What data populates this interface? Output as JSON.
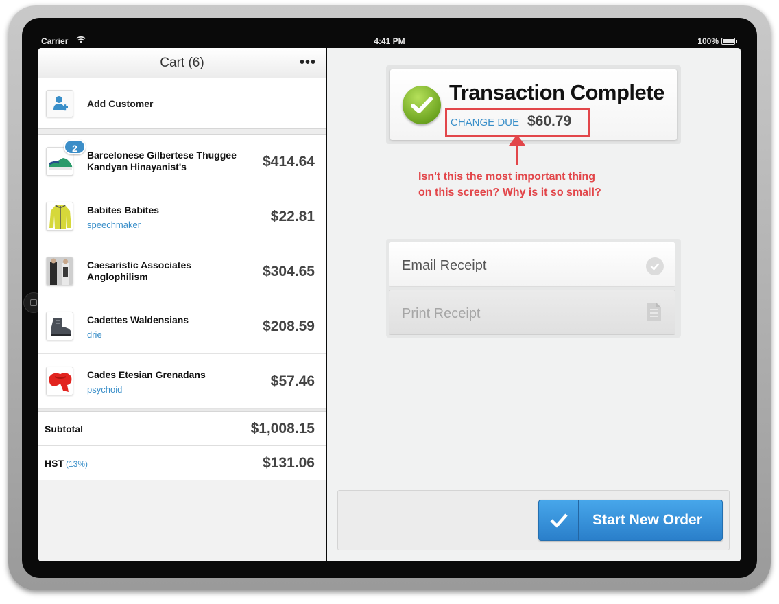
{
  "status_bar": {
    "carrier": "Carrier",
    "time": "4:41 PM",
    "battery": "100%"
  },
  "cart": {
    "title": "Cart (6)",
    "add_customer_label": "Add Customer",
    "items": [
      {
        "name": "Barcelonese Gilbertese Thuggee Kandyan Hinayanist's",
        "sub": "",
        "price": "$414.64",
        "qty_badge": "2",
        "image": "sneaker"
      },
      {
        "name": "Babites Babites",
        "sub": "speechmaker",
        "price": "$22.81",
        "image": "yellow-jacket"
      },
      {
        "name": "Caesaristic Associates Anglophilism",
        "sub": "",
        "price": "$304.65",
        "image": "fashion-models"
      },
      {
        "name": "Cadettes Waldensians",
        "sub": "drie",
        "price": "$208.59",
        "image": "boot"
      },
      {
        "name": "Cades Etesian Grenadans",
        "sub": "psychoid",
        "price": "$57.46",
        "image": "red-scarf"
      }
    ],
    "subtotal_label": "Subtotal",
    "subtotal_value": "$1,008.15",
    "tax_label": "HST",
    "tax_rate": "(13%)",
    "tax_value": "$131.06"
  },
  "transaction": {
    "title": "Transaction Complete",
    "change_due_label": "CHANGE DUE",
    "change_due_amount": "$60.79"
  },
  "annotation": {
    "line1": "Isn't this the most important thing",
    "line2": "on this screen? Why is it so small?",
    "color": "#e2464a"
  },
  "receipt": {
    "email_label": "Email Receipt",
    "print_label": "Print Receipt"
  },
  "actions": {
    "start_new_order_label": "Start New Order"
  },
  "colors": {
    "accent_blue": "#3a8fc9",
    "success_green": "#6ea521",
    "button_blue": "#2a7fca"
  }
}
